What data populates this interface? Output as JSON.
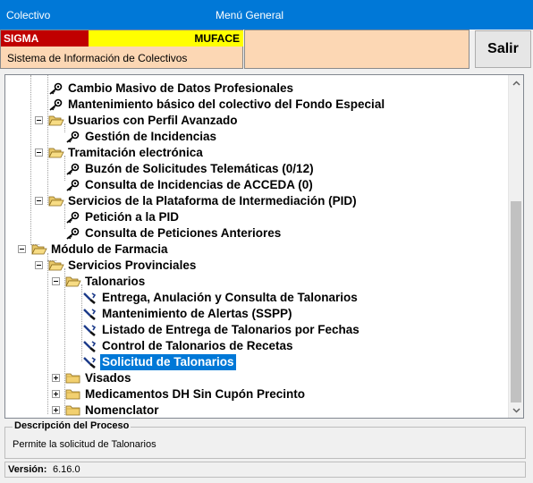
{
  "window": {
    "app_title": "Colectivo",
    "menu_title": "Menú General"
  },
  "header": {
    "sigma": "SIGMA",
    "muface": "MUFACE",
    "system_name": "Sistema de Información de Colectivos",
    "exit_label": "Salir"
  },
  "tree": {
    "items": [
      {
        "label": "Cambio Masivo de Datos Profesionales",
        "icon": "key-icon"
      },
      {
        "label": "Mantenimiento básico del colectivo del Fondo Especial",
        "icon": "key-icon"
      },
      {
        "label": "Usuarios con Perfil Avanzado",
        "icon": "folder-open-icon"
      },
      {
        "label": "Gestión de Incidencias",
        "icon": "key-icon"
      },
      {
        "label": "Tramitación electrónica",
        "icon": "folder-open-icon"
      },
      {
        "label": "Buzón de Solicitudes Telemáticas (0/12)",
        "icon": "key-icon"
      },
      {
        "label": "Consulta de Incidencias de ACCEDA (0)",
        "icon": "key-icon"
      },
      {
        "label": "Servicios de la Plataforma de Intermediación (PID)",
        "icon": "folder-open-icon"
      },
      {
        "label": "Petición a la PID",
        "icon": "key-icon"
      },
      {
        "label": "Consulta de Peticiones Anteriores",
        "icon": "key-icon"
      },
      {
        "label": "Módulo de Farmacia",
        "icon": "folder-open-icon"
      },
      {
        "label": "Servicios Provinciales",
        "icon": "folder-open-icon"
      },
      {
        "label": "Talonarios",
        "icon": "folder-open-icon"
      },
      {
        "label": "Entrega, Anulación y Consulta de Talonarios",
        "icon": "tool-icon"
      },
      {
        "label": "Mantenimiento de Alertas (SSPP)",
        "icon": "tool-icon"
      },
      {
        "label": "Listado de Entrega de Talonarios por Fechas",
        "icon": "tool-icon"
      },
      {
        "label": "Control de Talonarios de Recetas",
        "icon": "tool-icon"
      },
      {
        "label": "Solicitud de Talonarios",
        "icon": "tool-icon",
        "selected": true
      },
      {
        "label": "Visados",
        "icon": "folder-closed-icon"
      },
      {
        "label": "Medicamentos DH Sin Cupón Precinto",
        "icon": "folder-closed-icon"
      },
      {
        "label": "Nomenclator",
        "icon": "folder-closed-icon"
      }
    ]
  },
  "description": {
    "title": "Descripción del Proceso",
    "text": "Permite la solicitud de Talonarios"
  },
  "version": {
    "label": "Versión:",
    "value": "6.16.0"
  },
  "colors": {
    "titlebar": "#0078d7",
    "sigma": "#c00000",
    "muface": "#ffff00",
    "header_bg": "#fcd7b4",
    "selection": "#0078d7"
  }
}
